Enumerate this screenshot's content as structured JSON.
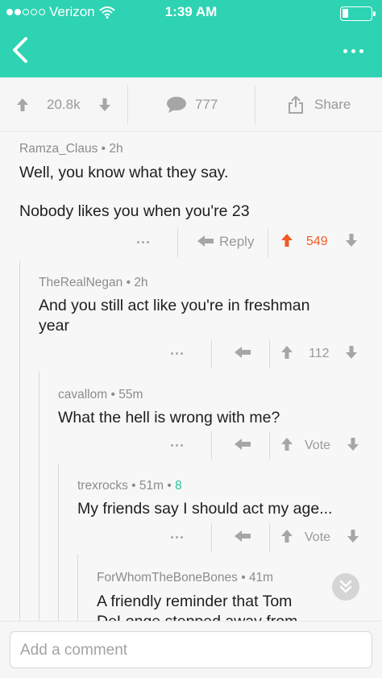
{
  "status_bar": {
    "carrier": "Verizon",
    "time": "1:39 AM"
  },
  "actions": {
    "upvotes": "20.8k",
    "comments": "777",
    "share_label": "Share"
  },
  "comments": [
    {
      "user": "Ramza_Claus",
      "age": "2h",
      "text_lines": [
        "Well, you know what they say.",
        "",
        "Nobody likes you when you're 23"
      ],
      "reply_label": "Reply",
      "score": "549"
    },
    {
      "user": "TheRealNegan",
      "age": "2h",
      "text_lines": [
        "And you still act like you're in freshman",
        "year"
      ],
      "score": "112"
    },
    {
      "user": "cavallom",
      "age": "55m",
      "text_lines": [
        "What the hell is wrong with me?"
      ],
      "score": "Vote"
    },
    {
      "user": "trexrocks",
      "age": "51m",
      "extra": "8",
      "text_lines": [
        "My friends say I should act my age..."
      ],
      "score": "Vote"
    },
    {
      "user": "ForWhomTheBoneBones",
      "age": "41m",
      "text_lines": [
        "A friendly reminder that Tom",
        "DeLonge stepped away from"
      ]
    }
  ],
  "composer": {
    "placeholder": "Add a comment"
  },
  "colors": {
    "accent": "#2dd3b3",
    "upvoted": "#f05a24",
    "muted": "#9a9a9a"
  }
}
